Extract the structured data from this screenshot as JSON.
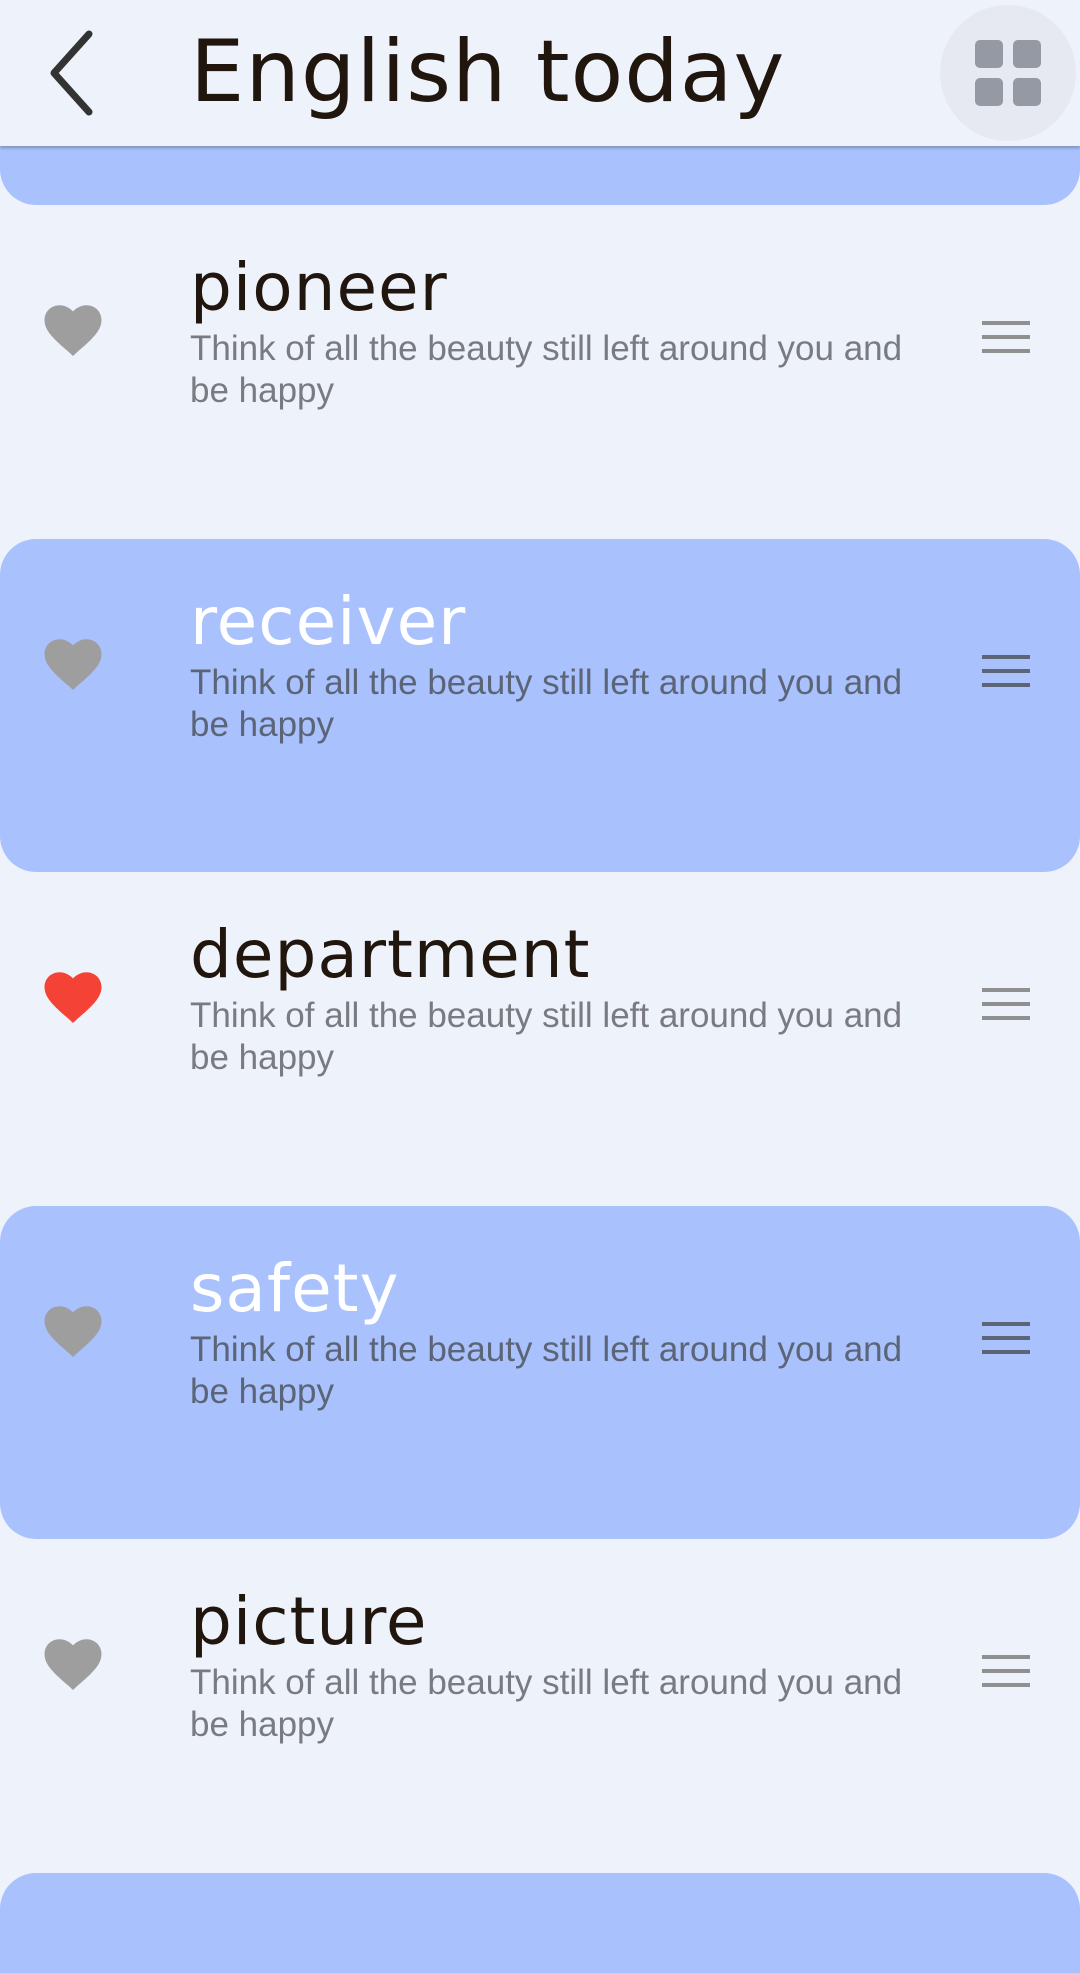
{
  "appbar": {
    "title": "English today",
    "back_icon": "chevron-left-icon",
    "grid_icon": "grid-view-icon"
  },
  "colors": {
    "background": "#EEF2FB",
    "highlight": "#A9C1FD",
    "heart_default": "#9E9E9E",
    "heart_active": "#F44336"
  },
  "items": [
    {
      "word": "pioneer",
      "description": "Think of all the beauty still left around you and be happy",
      "favorite": false,
      "highlighted": false
    },
    {
      "word": "receiver",
      "description": "Think of all the beauty still left around you and be happy",
      "favorite": false,
      "highlighted": true
    },
    {
      "word": "department",
      "description": "Think of all the beauty still left around you and be happy",
      "favorite": true,
      "highlighted": false
    },
    {
      "word": "safety",
      "description": "Think of all the beauty still left around you and be happy",
      "favorite": false,
      "highlighted": true
    },
    {
      "word": "picture",
      "description": "Think of all the beauty still left around you and be happy",
      "favorite": false,
      "highlighted": false
    }
  ]
}
